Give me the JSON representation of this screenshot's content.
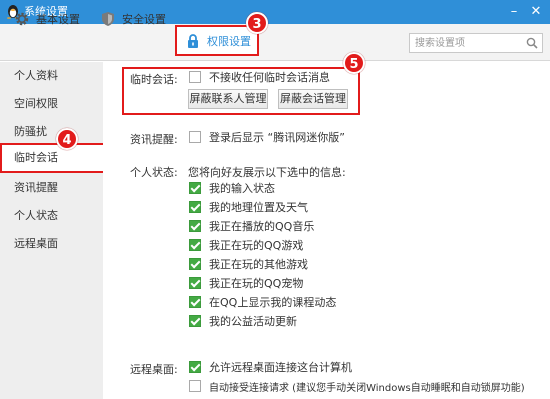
{
  "window": {
    "title": "系统设置",
    "minimize": "–",
    "close": "✕"
  },
  "tabs": [
    {
      "label": "基本设置",
      "icon": "gear-icon"
    },
    {
      "label": "安全设置",
      "icon": "shield-icon"
    },
    {
      "label": "权限设置",
      "icon": "lock-icon",
      "active": true
    }
  ],
  "search": {
    "placeholder": "搜索设置项"
  },
  "sidebar": {
    "items": [
      {
        "label": "个人资料"
      },
      {
        "label": "空间权限"
      },
      {
        "label": "防骚扰"
      },
      {
        "label": "临时会话",
        "active": true
      },
      {
        "label": "资讯提醒"
      },
      {
        "label": "个人状态"
      },
      {
        "label": "远程桌面"
      }
    ]
  },
  "temp_session": {
    "label": "临时会话:",
    "option": {
      "text": "不接收任何临时会话消息",
      "checked": false
    },
    "btn_contacts": "屏蔽联系人管理",
    "btn_sessions": "屏蔽会话管理"
  },
  "news": {
    "label": "资讯提醒:",
    "option": {
      "text": "登录后显示 “腾讯网迷你版”",
      "checked": false
    }
  },
  "status": {
    "label": "个人状态:",
    "intro": "您将向好友展示以下选中的信息:",
    "options": [
      {
        "text": "我的输入状态",
        "checked": true
      },
      {
        "text": "我的地理位置及天气",
        "checked": true
      },
      {
        "text": "我正在播放的QQ音乐",
        "checked": true
      },
      {
        "text": "我正在玩的QQ游戏",
        "checked": true
      },
      {
        "text": "我正在玩的其他游戏",
        "checked": true
      },
      {
        "text": "我正在玩的QQ宠物",
        "checked": true
      },
      {
        "text": "在QQ上显示我的课程动态",
        "checked": true
      },
      {
        "text": "我的公益活动更新",
        "checked": true
      }
    ]
  },
  "remote": {
    "label": "远程桌面:",
    "options": [
      {
        "text": "允许远程桌面连接这台计算机",
        "checked": true
      },
      {
        "text": "自动接受连接请求 (建议您手动关闭Windows自动睡眠和自动锁屏功能)",
        "checked": false
      }
    ]
  },
  "markers": {
    "m3": "3",
    "m4": "4",
    "m5": "5"
  },
  "colors": {
    "accent": "#2f8fd8",
    "highlight": "#e21b1b",
    "check": "#44aa44"
  }
}
